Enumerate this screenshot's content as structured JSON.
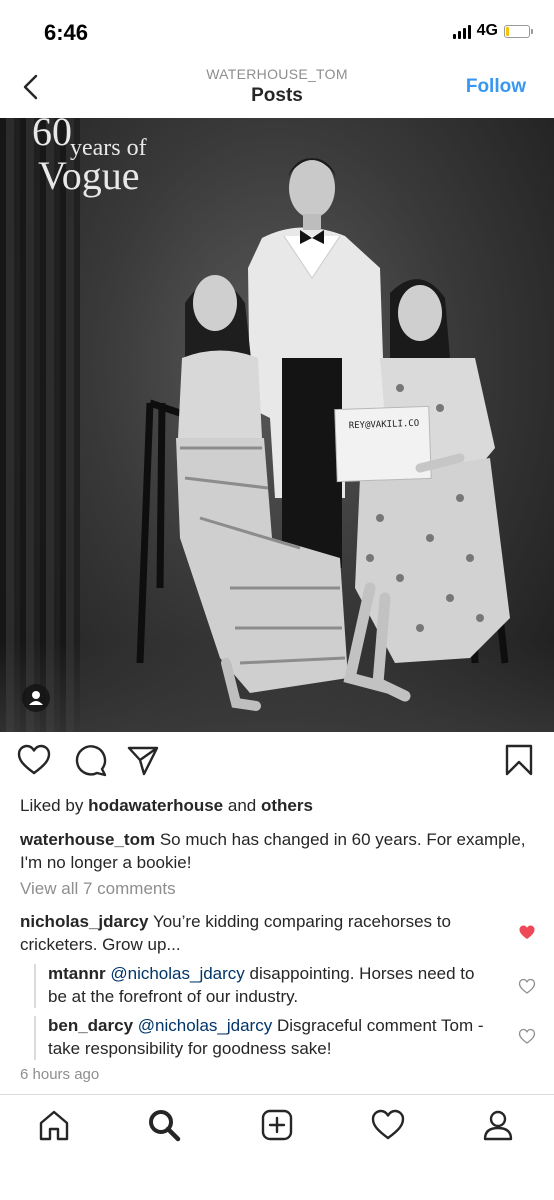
{
  "status": {
    "time": "6:46",
    "network": "4G",
    "battery_level": 0.15
  },
  "nav": {
    "account": "WATERHOUSE_TOM",
    "title": "Posts",
    "follow_label": "Follow"
  },
  "post": {
    "image_text": {
      "overlay_60": "60",
      "overlay_years": "years of",
      "overlay_vogue": "Vogue",
      "sign_text": "REY@VAKILI.CO"
    },
    "likes": {
      "prefix": "Liked by",
      "user": "hodawaterhouse",
      "and": "and",
      "others": "others"
    },
    "caption": {
      "user": "waterhouse_tom",
      "text": "So much has changed in 60 years. For example, I'm no longer a bookie!"
    },
    "view_all": "View all 7 comments",
    "comments": [
      {
        "user": "nicholas_jdarcy",
        "text": "You’re kidding comparing racehorses to cricketers. Grow up...",
        "liked": true
      },
      {
        "user": "mtannr",
        "mention": "@nicholas_jdarcy",
        "text": "disappointing. Horses need to be at the forefront of our industry.",
        "liked": false
      },
      {
        "user": "ben_darcy",
        "mention": "@nicholas_jdarcy",
        "text": "Disgraceful comment Tom - take responsibility for goodness sake!",
        "liked": false
      }
    ],
    "time_ago": "6 hours ago"
  },
  "colors": {
    "accent": "#3897f0",
    "text": "#262626",
    "muted": "#8e8e8e",
    "like_red": "#ed4956",
    "mention": "#003569"
  },
  "icons": {
    "actions": [
      "heart-icon",
      "comment-icon",
      "share-icon",
      "bookmark-icon"
    ],
    "tabs": [
      "home-icon",
      "search-icon",
      "add-post-icon",
      "activity-heart-icon",
      "profile-icon"
    ]
  }
}
